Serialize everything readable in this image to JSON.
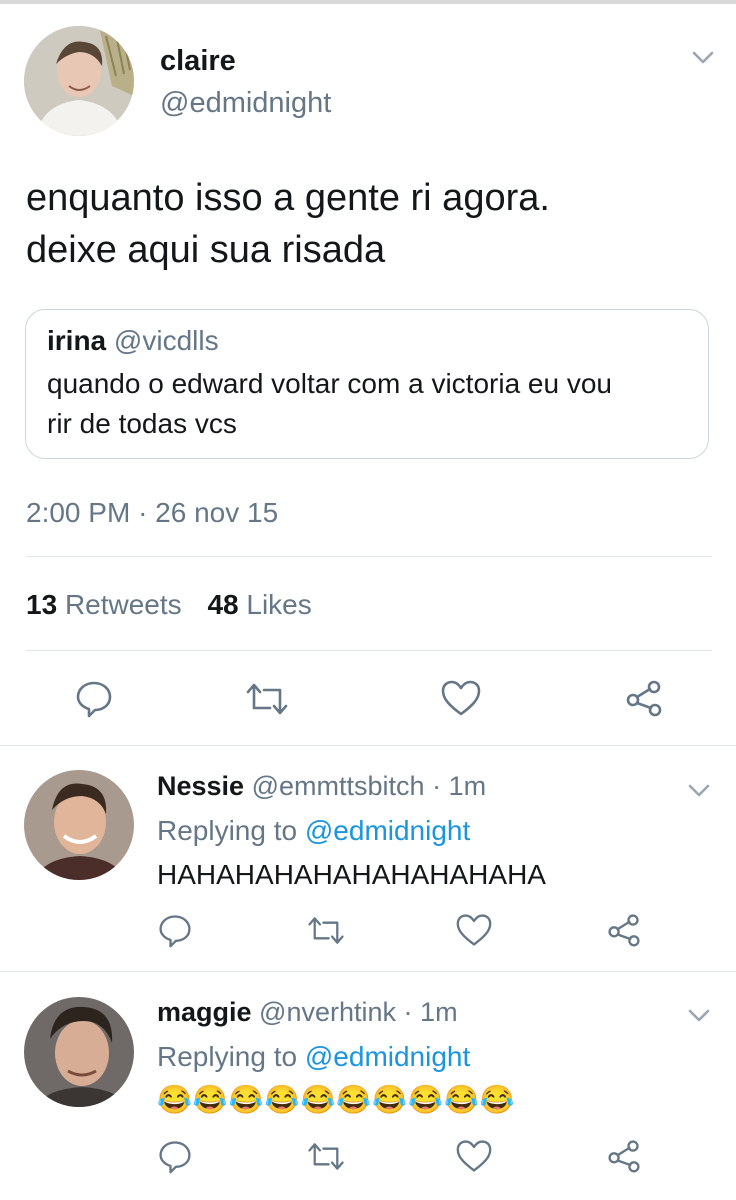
{
  "main_tweet": {
    "display_name": "claire",
    "handle": "@edmidnight",
    "text_line1": "enquanto isso a gente ri agora.",
    "text_line2": "deixe aqui sua risada",
    "quoted": {
      "display_name": "irina",
      "handle": "@vicdlls",
      "text_line1": "quando o edward voltar com a victoria eu vou",
      "text_line2": "rir de todas vcs"
    },
    "time": "2:00 PM",
    "date_sep": "·",
    "date": "26 nov 15",
    "retweets_count": "13",
    "retweets_label": "Retweets",
    "likes_count": "48",
    "likes_label": "Likes"
  },
  "replies": [
    {
      "display_name": "Nessie",
      "handle": "@emmttsbitch",
      "sep": "·",
      "age": "1m",
      "replying_prefix": "Replying to",
      "replying_handle": "@edmidnight",
      "text": "HAHAHAHAHAHAHAHAHAHA"
    },
    {
      "display_name": "maggie",
      "handle": "@nverhtink",
      "sep": "·",
      "age": "1m",
      "replying_prefix": "Replying to",
      "replying_handle": "@edmidnight",
      "emoji": "😂",
      "emoji_count": 10
    }
  ],
  "icons": {
    "chevron": "chevron-down-icon",
    "reply": "reply-icon",
    "retweet": "retweet-icon",
    "like": "heart-icon",
    "share": "share-icon"
  },
  "colors": {
    "link": "#1b95e0",
    "muted": "#657786",
    "divider": "#e1e8ed"
  }
}
